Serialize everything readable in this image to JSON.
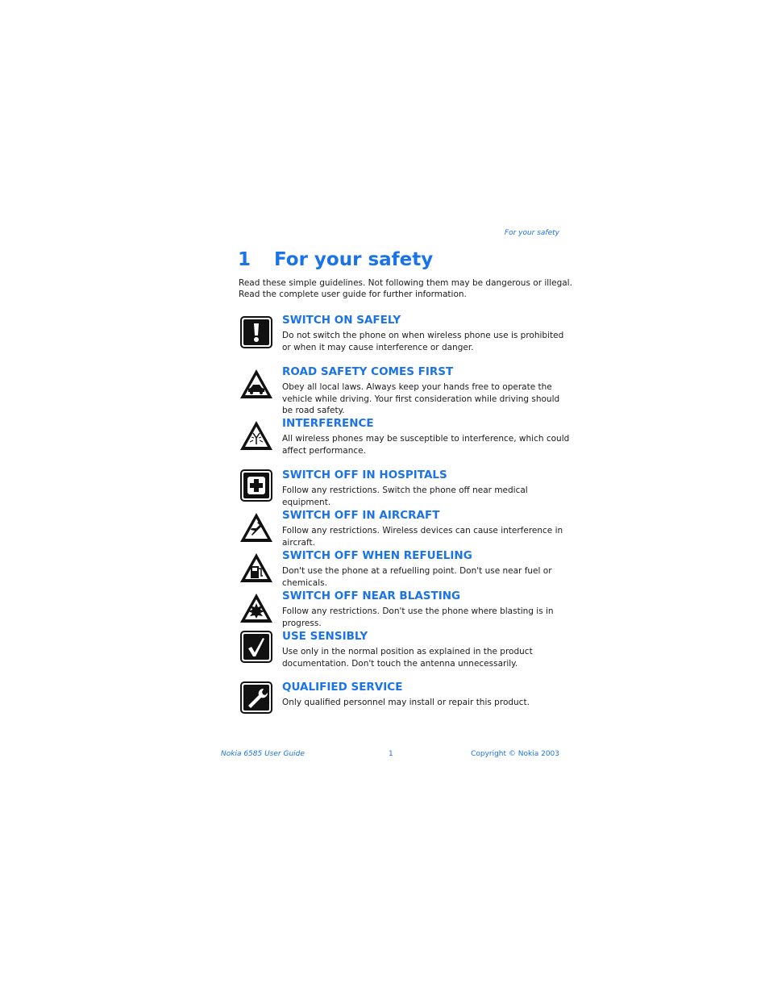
{
  "running_head": "For your safety",
  "chapter": {
    "number": "1",
    "title": "For your safety"
  },
  "intro": "Read these simple guidelines. Not following them may be dangerous or illegal. Read the complete user guide for further information.",
  "items": [
    {
      "icon": "exclamation-icon",
      "title": "SWITCH ON SAFELY",
      "desc": "Do not switch the phone on when wireless phone use is prohibited or when it may cause interference or danger."
    },
    {
      "icon": "car-warning-icon",
      "title": "ROAD SAFETY COMES FIRST",
      "desc": "Obey all local laws. Always keep your hands free to operate the vehicle while driving. Your first consideration while driving should be road safety."
    },
    {
      "icon": "antenna-warning-icon",
      "title": "INTERFERENCE",
      "desc": "All wireless phones may be susceptible to interference, which could affect performance."
    },
    {
      "icon": "medical-cross-icon",
      "title": "SWITCH OFF IN HOSPITALS",
      "desc": "Follow any restrictions. Switch the phone off near medical equipment."
    },
    {
      "icon": "airplane-warning-icon",
      "title": "SWITCH OFF IN AIRCRAFT",
      "desc": "Follow any restrictions. Wireless devices can cause interference in aircraft."
    },
    {
      "icon": "fuel-pump-warning-icon",
      "title": "SWITCH OFF WHEN REFUELING",
      "desc": "Don't use the phone at a refuelling point. Don't use near fuel or chemicals."
    },
    {
      "icon": "explosion-warning-icon",
      "title": "SWITCH OFF NEAR BLASTING",
      "desc": "Follow any restrictions. Don't use the phone where blasting is in progress."
    },
    {
      "icon": "checkmark-icon",
      "title": "USE SENSIBLY",
      "desc": "Use only in the normal position as explained in the product documentation. Don't touch the antenna unnecessarily."
    },
    {
      "icon": "wrench-icon",
      "title": "QUALIFIED SERVICE",
      "desc": "Only qualified personnel may install or repair this product."
    }
  ],
  "footer": {
    "left": "Nokia 6585 User Guide",
    "page": "1",
    "right": "Copyright © Nokia 2003"
  },
  "colors": {
    "accent": "#1a73e8",
    "text": "#1a1a1a"
  }
}
